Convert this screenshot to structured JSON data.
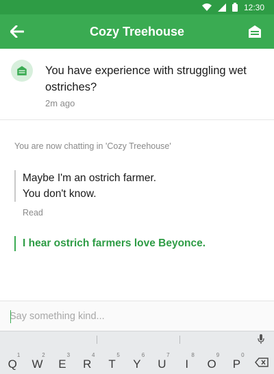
{
  "status_bar": {
    "time": "12:30"
  },
  "header": {
    "title": "Cozy Treehouse"
  },
  "prompt": {
    "question": "You have experience with struggling wet ostriches?",
    "time_ago": "2m ago"
  },
  "chat": {
    "system_message": "You are now chatting in 'Cozy Treehouse'",
    "incoming_lines": [
      "Maybe I'm an ostrich farmer.",
      "You don't know."
    ],
    "read_receipt": "Read",
    "outgoing_message": "I hear ostrich farmers love Beyonce."
  },
  "compose": {
    "placeholder": "Say something kind..."
  },
  "keyboard": {
    "keys": [
      {
        "label": "Q",
        "hint": "1"
      },
      {
        "label": "W",
        "hint": "2"
      },
      {
        "label": "E",
        "hint": "3"
      },
      {
        "label": "R",
        "hint": "4"
      },
      {
        "label": "T",
        "hint": "5"
      },
      {
        "label": "Y",
        "hint": "6"
      },
      {
        "label": "U",
        "hint": "7"
      },
      {
        "label": "I",
        "hint": "8"
      },
      {
        "label": "O",
        "hint": "9"
      },
      {
        "label": "P",
        "hint": "0"
      }
    ]
  },
  "icons": {
    "back": "arrow-left-icon",
    "header_action": "treehouse-icon",
    "avatar": "treehouse-icon",
    "mic": "mic-icon",
    "delete": "backspace-icon"
  },
  "colors": {
    "brand": "#3aab52",
    "brand_dark": "#2e9c45"
  }
}
